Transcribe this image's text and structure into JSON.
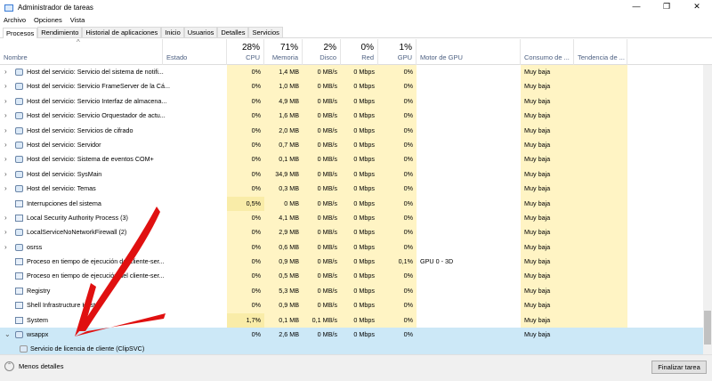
{
  "window": {
    "title": "Administrador de tareas",
    "minimize": "—",
    "maximize": "❐",
    "close": "✕"
  },
  "menu": [
    "Archivo",
    "Opciones",
    "Vista"
  ],
  "tabs": [
    "Procesos",
    "Rendimiento",
    "Historial de aplicaciones",
    "Inicio",
    "Usuarios",
    "Detalles",
    "Servicios"
  ],
  "columns": {
    "name": "Nombre",
    "status": "Estado",
    "cpu": {
      "label": "CPU",
      "pct": "28%"
    },
    "memory": {
      "label": "Memoria",
      "pct": "71%"
    },
    "disk": {
      "label": "Disco",
      "pct": "2%"
    },
    "network": {
      "label": "Red",
      "pct": "0%"
    },
    "gpu": {
      "label": "GPU",
      "pct": "1%"
    },
    "gpu_engine": "Motor de GPU",
    "power": "Consumo de ...",
    "power_trend": "Tendencia de ..."
  },
  "rows": [
    {
      "name": "Host del servicio: Servicio del sistema de notifi...",
      "cpu": "0%",
      "mem": "1,4 MB",
      "disk": "0 MB/s",
      "net": "0 Mbps",
      "gpu": "0%",
      "engine": "",
      "power": "Muy baja",
      "icon": "gear",
      "exp": "›"
    },
    {
      "name": "Host del servicio: Servicio FrameServer de la Cá...",
      "cpu": "0%",
      "mem": "1,0 MB",
      "disk": "0 MB/s",
      "net": "0 Mbps",
      "gpu": "0%",
      "engine": "",
      "power": "Muy baja",
      "icon": "gear",
      "exp": "›"
    },
    {
      "name": "Host del servicio: Servicio Interfaz de almacena...",
      "cpu": "0%",
      "mem": "4,9 MB",
      "disk": "0 MB/s",
      "net": "0 Mbps",
      "gpu": "0%",
      "engine": "",
      "power": "Muy baja",
      "icon": "gear",
      "exp": "›"
    },
    {
      "name": "Host del servicio: Servicio Orquestador de actu...",
      "cpu": "0%",
      "mem": "1,6 MB",
      "disk": "0 MB/s",
      "net": "0 Mbps",
      "gpu": "0%",
      "engine": "",
      "power": "Muy baja",
      "icon": "gear",
      "exp": "›"
    },
    {
      "name": "Host del servicio: Servicios de cifrado",
      "cpu": "0%",
      "mem": "2,0 MB",
      "disk": "0 MB/s",
      "net": "0 Mbps",
      "gpu": "0%",
      "engine": "",
      "power": "Muy baja",
      "icon": "gear",
      "exp": "›"
    },
    {
      "name": "Host del servicio: Servidor",
      "cpu": "0%",
      "mem": "0,7 MB",
      "disk": "0 MB/s",
      "net": "0 Mbps",
      "gpu": "0%",
      "engine": "",
      "power": "Muy baja",
      "icon": "gear",
      "exp": "›"
    },
    {
      "name": "Host del servicio: Sistema de eventos COM+",
      "cpu": "0%",
      "mem": "0,1 MB",
      "disk": "0 MB/s",
      "net": "0 Mbps",
      "gpu": "0%",
      "engine": "",
      "power": "Muy baja",
      "icon": "gear",
      "exp": "›"
    },
    {
      "name": "Host del servicio: SysMain",
      "cpu": "0%",
      "mem": "34,9 MB",
      "disk": "0 MB/s",
      "net": "0 Mbps",
      "gpu": "0%",
      "engine": "",
      "power": "Muy baja",
      "icon": "gear",
      "exp": "›"
    },
    {
      "name": "Host del servicio: Temas",
      "cpu": "0%",
      "mem": "0,3 MB",
      "disk": "0 MB/s",
      "net": "0 Mbps",
      "gpu": "0%",
      "engine": "",
      "power": "Muy baja",
      "icon": "gear",
      "exp": "›"
    },
    {
      "name": "Interrupciones del sistema",
      "cpu": "0,5%",
      "mem": "0 MB",
      "disk": "0 MB/s",
      "net": "0 Mbps",
      "gpu": "0%",
      "engine": "",
      "power": "Muy baja",
      "icon": "app",
      "exp": ""
    },
    {
      "name": "Local Security Authority Process (3)",
      "cpu": "0%",
      "mem": "4,1 MB",
      "disk": "0 MB/s",
      "net": "0 Mbps",
      "gpu": "0%",
      "engine": "",
      "power": "Muy baja",
      "icon": "app",
      "exp": "›"
    },
    {
      "name": "LocalServiceNoNetworkFirewall (2)",
      "cpu": "0%",
      "mem": "2,9 MB",
      "disk": "0 MB/s",
      "net": "0 Mbps",
      "gpu": "0%",
      "engine": "",
      "power": "Muy baja",
      "icon": "gear",
      "exp": "›"
    },
    {
      "name": "osrss",
      "cpu": "0%",
      "mem": "0,6 MB",
      "disk": "0 MB/s",
      "net": "0 Mbps",
      "gpu": "0%",
      "engine": "",
      "power": "Muy baja",
      "icon": "gear",
      "exp": "›"
    },
    {
      "name": "Proceso en tiempo de ejecución del cliente-ser...",
      "cpu": "0%",
      "mem": "0,9 MB",
      "disk": "0 MB/s",
      "net": "0 Mbps",
      "gpu": "0,1%",
      "engine": "GPU 0 - 3D",
      "power": "Muy baja",
      "icon": "app",
      "exp": ""
    },
    {
      "name": "Proceso en tiempo de ejecución del cliente-ser...",
      "cpu": "0%",
      "mem": "0,5 MB",
      "disk": "0 MB/s",
      "net": "0 Mbps",
      "gpu": "0%",
      "engine": "",
      "power": "Muy baja",
      "icon": "app",
      "exp": ""
    },
    {
      "name": "Registry",
      "cpu": "0%",
      "mem": "5,3 MB",
      "disk": "0 MB/s",
      "net": "0 Mbps",
      "gpu": "0%",
      "engine": "",
      "power": "Muy baja",
      "icon": "app",
      "exp": ""
    },
    {
      "name": "Shell Infrastructure Host",
      "cpu": "0%",
      "mem": "0,9 MB",
      "disk": "0 MB/s",
      "net": "0 Mbps",
      "gpu": "0%",
      "engine": "",
      "power": "Muy baja",
      "icon": "app",
      "exp": ""
    },
    {
      "name": "System",
      "cpu": "1,7%",
      "mem": "0,1 MB",
      "disk": "0,1 MB/s",
      "net": "0 Mbps",
      "gpu": "0%",
      "engine": "",
      "power": "Muy baja",
      "icon": "app",
      "exp": ""
    },
    {
      "name": "wsappx",
      "cpu": "0%",
      "mem": "2,6 MB",
      "disk": "0 MB/s",
      "net": "0 Mbps",
      "gpu": "0%",
      "engine": "",
      "power": "Muy baja",
      "icon": "gear",
      "exp": "⌄",
      "selected": true
    }
  ],
  "child_row": {
    "name": "Servicio de licencia de cliente (ClipSVC)"
  },
  "footer": {
    "less_details": "Menos detalles",
    "end_task": "Finalizar tarea"
  },
  "colors": {
    "selection": "#cce8f7",
    "heat": "#fff4c4",
    "annotation_arrow": "#e01010"
  }
}
